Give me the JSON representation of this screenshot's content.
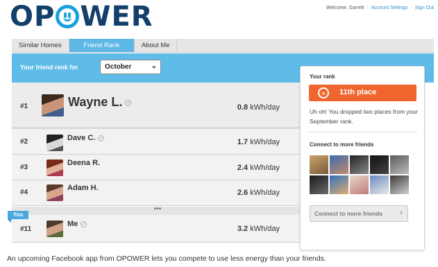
{
  "brand": {
    "name_pre": "OP",
    "name_post": "WER"
  },
  "header": {
    "welcome": "Welcome, Garrett",
    "sep": "·",
    "account_settings": "Account Settings",
    "sign_out": "Sign Out"
  },
  "tabs": [
    {
      "label": "Similar Homes",
      "active": false
    },
    {
      "label": "Friend Rank",
      "active": true
    },
    {
      "label": "About Me",
      "active": false
    }
  ],
  "filter": {
    "label": "Your friend rank for",
    "month": "October",
    "chevron": "⌄"
  },
  "rows": [
    {
      "rank": "#1",
      "name": "Wayne L.",
      "value": "0.8",
      "unit": "kWh/day",
      "verified": true
    },
    {
      "rank": "#2",
      "name": "Dave C.",
      "value": "1.7",
      "unit": "kWh/day",
      "verified": true
    },
    {
      "rank": "#3",
      "name": "Deena R.",
      "value": "2.4",
      "unit": "kWh/day",
      "verified": false
    },
    {
      "rank": "#4",
      "name": "Adam H.",
      "value": "2.6",
      "unit": "kWh/day",
      "verified": false
    },
    {
      "rank": "#11",
      "name": "Me",
      "value": "3.2",
      "unit": "kWh/day",
      "verified": true
    }
  ],
  "ellipsis": "•••",
  "you_badge": "You",
  "check_glyph": "✓",
  "panel": {
    "title": "Your rank",
    "rank_text": "11th place",
    "rank_icon": "»",
    "message": "Uh oh! You dropped two places from your September rank.",
    "connect_title": "Connect to more friends",
    "connect_button": "Connect to more friends",
    "button_chevron": "›"
  },
  "caption": "An upcoming Facebook app from OPOWER lets you compete to use less energy than your friends.",
  "colors": {
    "accent_blue": "#5fbbe8",
    "brand_navy": "#13406b",
    "rank_orange": "#f0652d"
  }
}
